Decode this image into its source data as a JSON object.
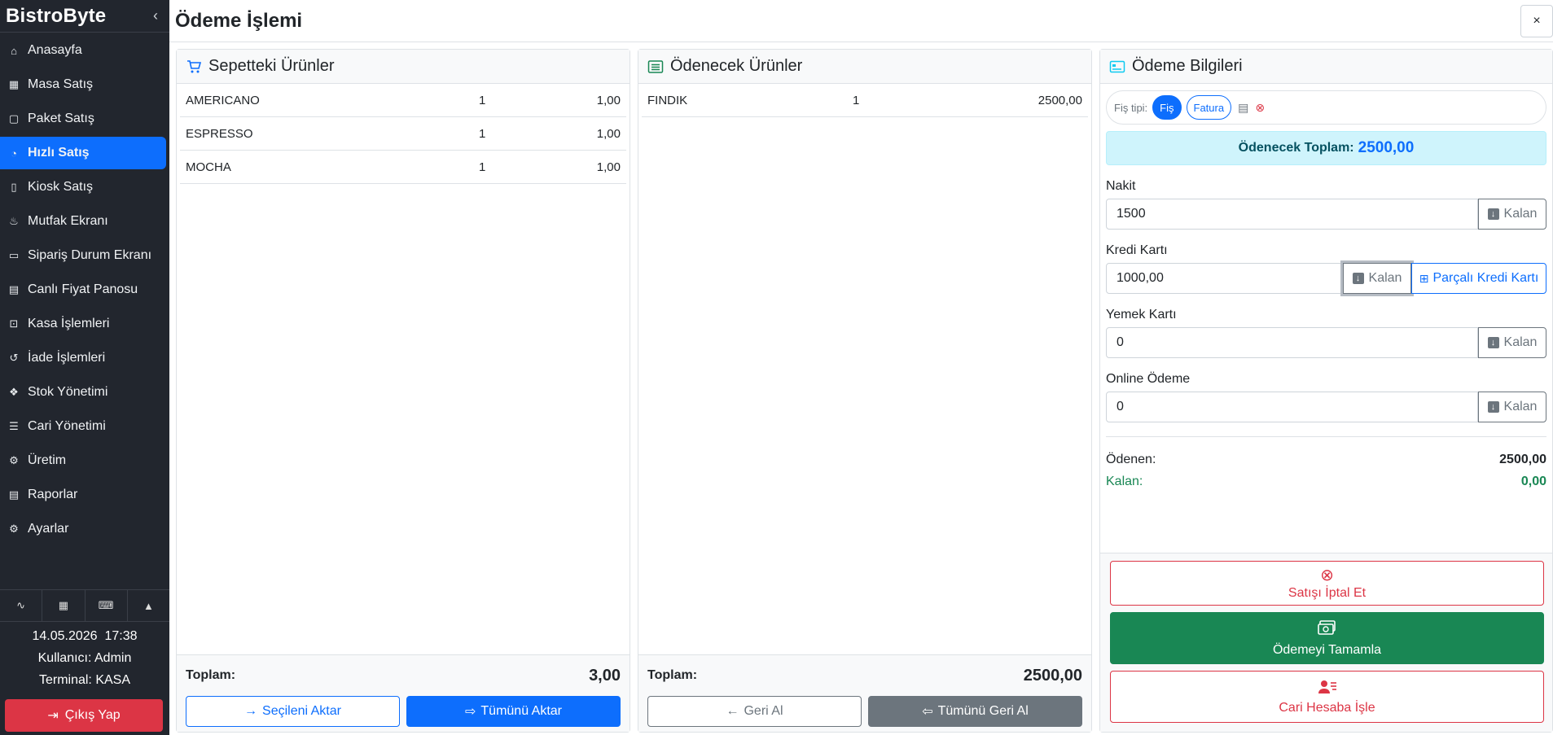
{
  "app": {
    "brand": "BistroByte",
    "collapse_icon": "chevron-left-icon"
  },
  "sidebar": {
    "items": [
      {
        "label": "Anasayfa",
        "icon": "home-icon",
        "glyph": "⌂"
      },
      {
        "label": "Masa Satış",
        "icon": "grid-icon",
        "glyph": "▦"
      },
      {
        "label": "Paket Satış",
        "icon": "box-icon",
        "glyph": "▢"
      },
      {
        "label": "Hızlı Satış",
        "icon": "speedometer-icon",
        "glyph": "◔",
        "active": true
      },
      {
        "label": "Kiosk Satış",
        "icon": "tablet-icon",
        "glyph": "▯"
      },
      {
        "label": "Mutfak Ekranı",
        "icon": "fire-icon",
        "glyph": "♨"
      },
      {
        "label": "Sipariş Durum Ekranı",
        "icon": "monitor-icon",
        "glyph": "▭"
      },
      {
        "label": "Canlı Fiyat Panosu",
        "icon": "dashboard-icon",
        "glyph": "▤"
      },
      {
        "label": "Kasa İşlemleri",
        "icon": "cash-register-icon",
        "glyph": "⊡"
      },
      {
        "label": "İade İşlemleri",
        "icon": "undo-icon",
        "glyph": "↺"
      },
      {
        "label": "Stok Yönetimi",
        "icon": "boxes-icon",
        "glyph": "❖"
      },
      {
        "label": "Cari Yönetimi",
        "icon": "person-lines-icon",
        "glyph": "☰"
      },
      {
        "label": "Üretim",
        "icon": "gear-icon",
        "glyph": "⚙"
      },
      {
        "label": "Raporlar",
        "icon": "file-icon",
        "glyph": "▤"
      },
      {
        "label": "Ayarlar",
        "icon": "settings-icon",
        "glyph": "⚙"
      }
    ],
    "tools": [
      {
        "icon": "activity-icon",
        "glyph": "∿"
      },
      {
        "icon": "calculator-icon",
        "glyph": "▦"
      },
      {
        "icon": "keyboard-icon",
        "glyph": "⌨"
      },
      {
        "icon": "bell-icon",
        "glyph": "🔔"
      }
    ],
    "date": "14.05.2026",
    "time": "17:38",
    "user_line": "Kullanıcı: Admin",
    "terminal_line": "Terminal: KASA",
    "logout_label": "Çıkış Yap"
  },
  "header": {
    "title": "Ödeme İşlemi",
    "close": "×"
  },
  "cart": {
    "title": "Sepetteki Ürünler",
    "items": [
      {
        "name": "AMERICANO",
        "qty": "1",
        "price": "1,00"
      },
      {
        "name": "ESPRESSO",
        "qty": "1",
        "price": "1,00"
      },
      {
        "name": "MOCHA",
        "qty": "1",
        "price": "1,00"
      }
    ],
    "total_label": "Toplam:",
    "total_value": "3,00",
    "btn_selected": "Seçileni Aktar",
    "btn_all": "Tümünü Aktar"
  },
  "pay_items": {
    "title": "Ödenecek Ürünler",
    "items": [
      {
        "name": "FINDIK",
        "qty": "1",
        "price": "2500,00"
      }
    ],
    "total_label": "Toplam:",
    "total_value": "2500,00",
    "btn_back": "Geri Al",
    "btn_all_back": "Tümünü Geri Al"
  },
  "payment": {
    "title": "Ödeme Bilgileri",
    "fis_label": "Fiş tipi:",
    "fis_options": [
      "Fiş",
      "Fatura"
    ],
    "total_label": "Ödenecek Toplam:",
    "total_value": "2500,00",
    "kalan_label": "Kalan",
    "fields": {
      "nakit": {
        "label": "Nakit",
        "value": "1500"
      },
      "kredi": {
        "label": "Kredi Kartı",
        "value": "1000,00",
        "split_label": "Parçalı Kredi Kartı"
      },
      "yemek": {
        "label": "Yemek Kartı",
        "value": "0"
      },
      "online": {
        "label": "Online Ödeme",
        "value": "0"
      }
    },
    "paid_label": "Ödenen:",
    "paid_value": "2500,00",
    "remaining_label": "Kalan:",
    "remaining_value": "0,00",
    "cancel_label": "Satışı İptal Et",
    "complete_label": "Ödemeyi Tamamla",
    "account_label": "Cari Hesaba İşle"
  },
  "colors": {
    "primary": "#0d6efd",
    "success": "#198754",
    "danger": "#dc3545",
    "sidebar": "#22262e"
  }
}
